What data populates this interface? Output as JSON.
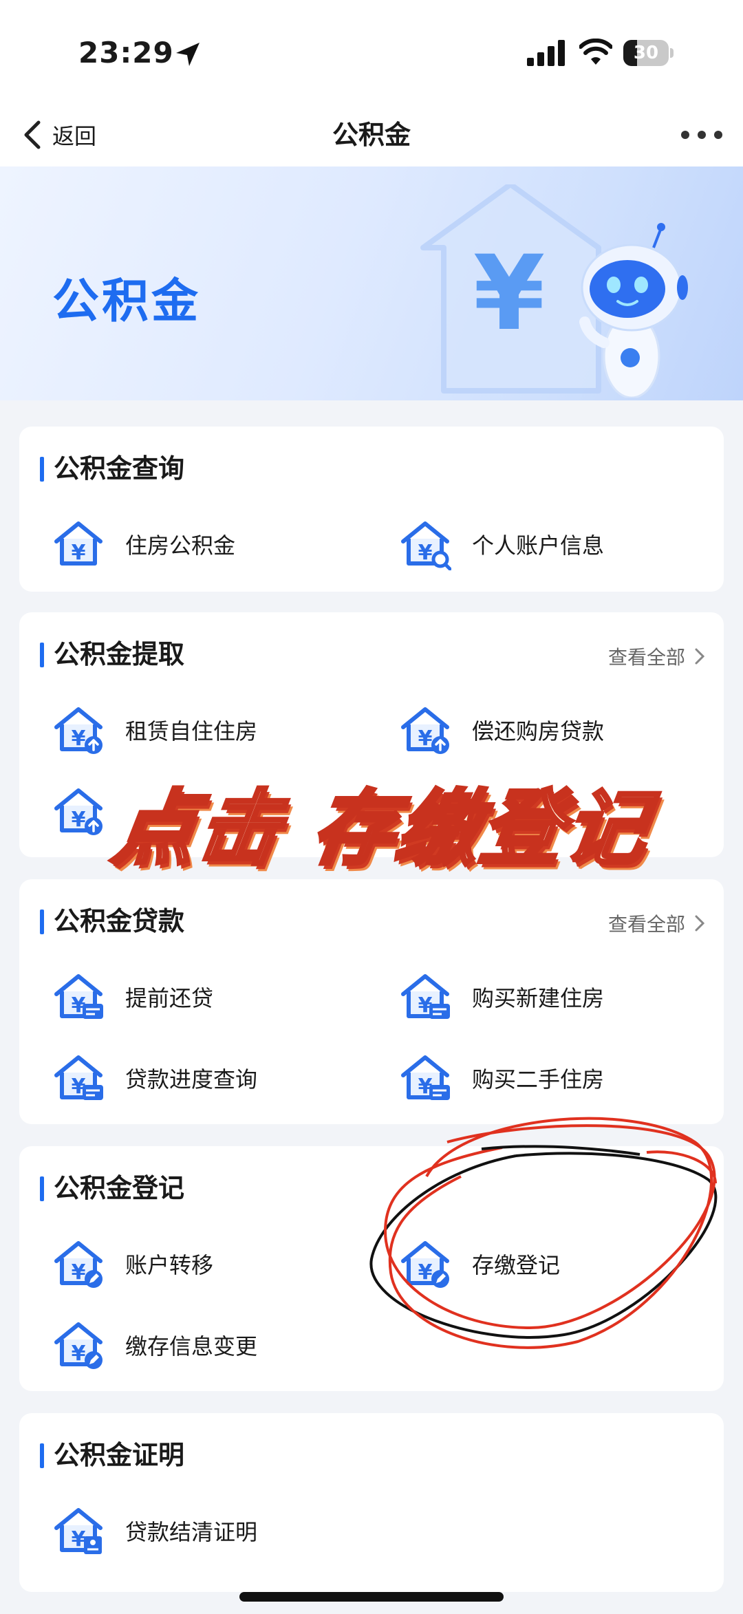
{
  "status_bar": {
    "time": "23:29",
    "battery": "30",
    "battery_level": 0.3
  },
  "nav": {
    "back_label": "返回",
    "title": "公积金"
  },
  "banner": {
    "title": "公积金"
  },
  "sections": [
    {
      "title": "公积金查询",
      "see_all": "",
      "items": [
        {
          "label": "住房公积金",
          "icon": "house-yuan-icon"
        },
        {
          "label": "个人账户信息",
          "icon": "house-yuan-search-icon"
        }
      ]
    },
    {
      "title": "公积金提取",
      "see_all": "查看全部",
      "items": [
        {
          "label": "租赁自住住房",
          "icon": "house-yuan-upload-icon"
        },
        {
          "label": "偿还购房贷款",
          "icon": "house-yuan-upload-icon"
        },
        {
          "label": "",
          "icon": "house-yuan-upload-icon"
        }
      ]
    },
    {
      "title": "公积金贷款",
      "see_all": "查看全部",
      "items": [
        {
          "label": "提前还贷",
          "icon": "house-yuan-card-icon"
        },
        {
          "label": "购买新建住房",
          "icon": "house-yuan-card-icon"
        },
        {
          "label": "贷款进度查询",
          "icon": "house-yuan-card-icon"
        },
        {
          "label": "购买二手住房",
          "icon": "house-yuan-card-icon"
        }
      ]
    },
    {
      "title": "公积金登记",
      "see_all": "",
      "items": [
        {
          "label": "账户转移",
          "icon": "house-yuan-edit-icon"
        },
        {
          "label": "存缴登记",
          "icon": "house-yuan-edit-icon"
        },
        {
          "label": "缴存信息变更",
          "icon": "house-yuan-edit-icon"
        }
      ]
    },
    {
      "title": "公积金证明",
      "see_all": "",
      "items": [
        {
          "label": "贷款结清证明",
          "icon": "house-yuan-cert-icon"
        }
      ]
    }
  ],
  "overlay": {
    "instruction": "点击 存缴登记"
  },
  "colors": {
    "accent": "#1e6cf0",
    "icon_light": "#7fb1f7",
    "overlay_stroke": "#c8321e",
    "scribble_red": "#e0311f"
  }
}
